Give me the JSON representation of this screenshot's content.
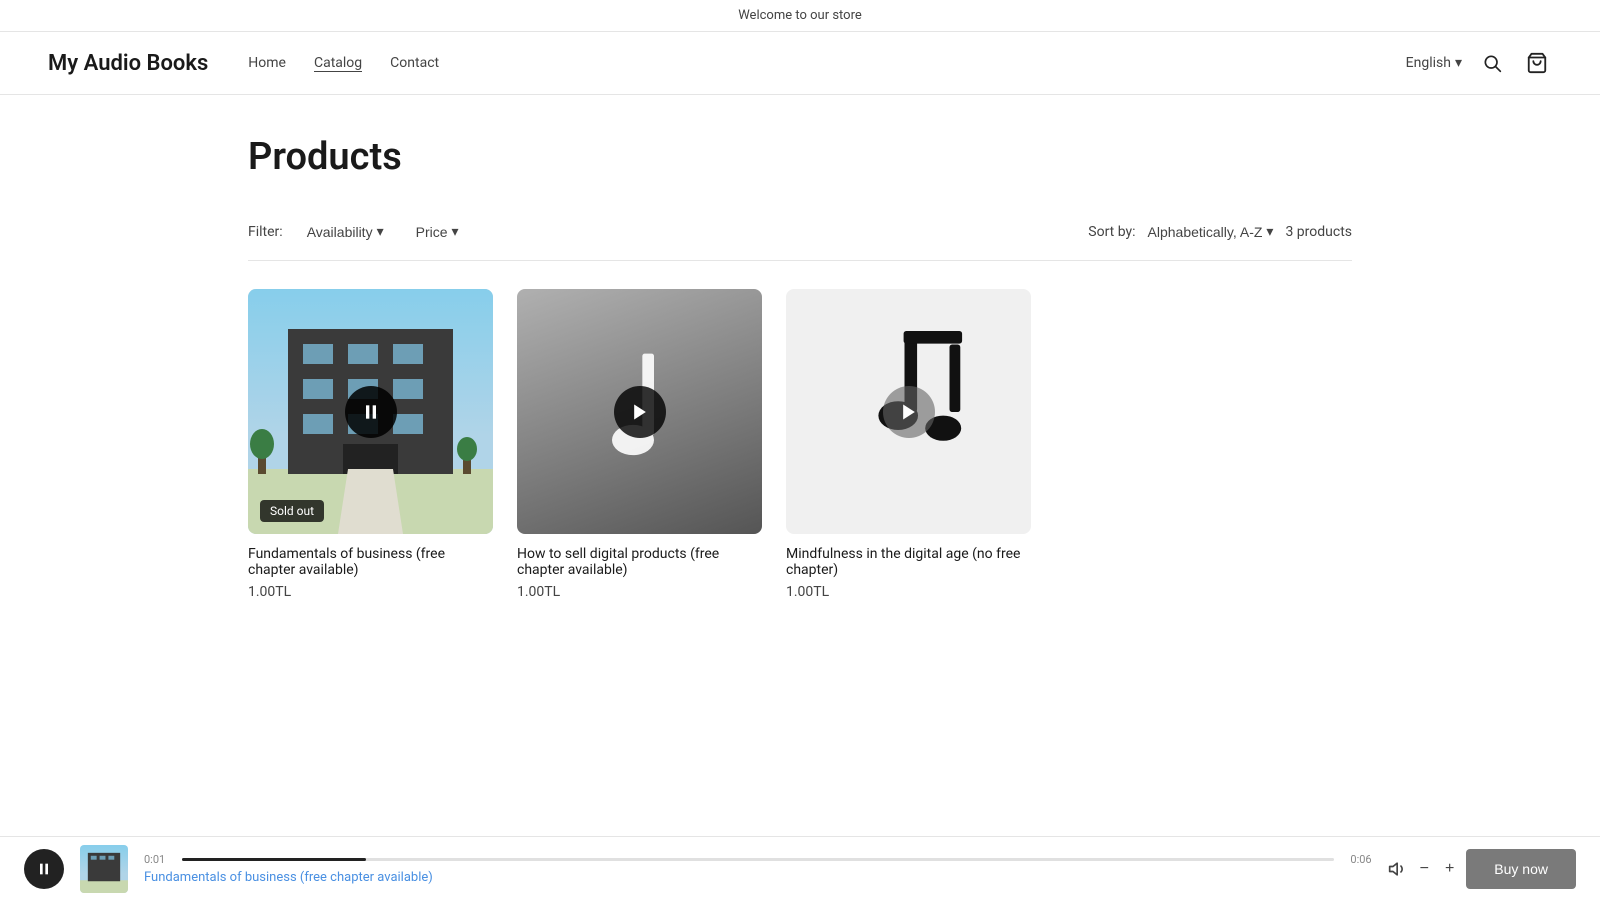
{
  "banner": {
    "text": "Welcome to our store"
  },
  "header": {
    "logo": "My Audio Books",
    "nav": [
      {
        "label": "Home",
        "active": false
      },
      {
        "label": "Catalog",
        "active": true
      },
      {
        "label": "Contact",
        "active": false
      }
    ],
    "lang": "English",
    "lang_chevron": "▾"
  },
  "main": {
    "page_title": "Products",
    "filter_label": "Filter:",
    "availability_label": "Availability",
    "price_label": "Price",
    "sort_by_label": "Sort by:",
    "sort_value": "Alphabetically, A-Z",
    "product_count": "3 products",
    "chevron": "▾"
  },
  "products": [
    {
      "id": "p1",
      "name": "Fundamentals of business (free chapter available)",
      "price": "1.00TL",
      "sold_out": true,
      "playing": true,
      "image_type": "building"
    },
    {
      "id": "p2",
      "name": "How to sell digital products (free chapter available)",
      "price": "1.00TL",
      "sold_out": false,
      "playing": false,
      "image_type": "music_gradient"
    },
    {
      "id": "p3",
      "name": "Mindfulness in the digital age (no free chapter)",
      "price": "1.00TL",
      "sold_out": false,
      "playing": false,
      "image_type": "music_note"
    }
  ],
  "player": {
    "track_name": "Fundamentals of business (free chapter available)",
    "time_current": "0:01",
    "time_total": "0:06",
    "progress_percent": 16,
    "buy_now_label": "Buy now",
    "sold_out_label": "Sold out"
  }
}
